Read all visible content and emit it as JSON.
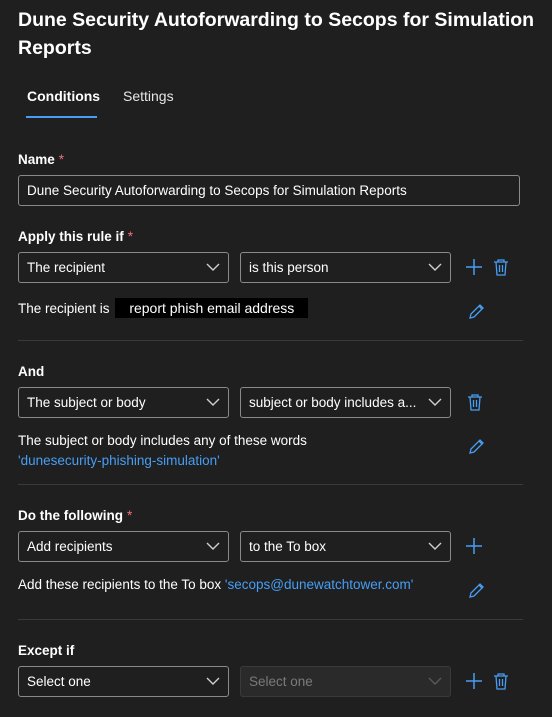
{
  "header": {
    "title": "Dune Security Autoforwarding to Secops for Simulation Reports"
  },
  "tabs": [
    {
      "label": "Conditions",
      "active": true
    },
    {
      "label": "Settings",
      "active": false
    }
  ],
  "name_section": {
    "label": "Name",
    "required_mark": "*",
    "value": "Dune Security Autoforwarding to Secops for Simulation Reports"
  },
  "apply_rule": {
    "label": "Apply this rule if",
    "required_mark": "*",
    "condition": "The recipient",
    "operator": "is this person",
    "desc_prefix": "The recipient is",
    "desc_redacted": "report phish email address"
  },
  "and_section": {
    "label": "And",
    "condition": "The subject or body",
    "operator": "subject or body includes a...",
    "desc_line1": "The subject or body includes any of these words",
    "desc_link": "'dunesecurity-phishing-simulation'"
  },
  "do_following": {
    "label": "Do the following",
    "required_mark": "*",
    "action": "Add recipients",
    "target": "to the To box",
    "desc_prefix": "Add these recipients to the To box",
    "desc_link": "'secops@dunewatchtower.com'"
  },
  "except_if": {
    "label": "Except if",
    "condition": "Select one",
    "operator": "Select one"
  },
  "colors": {
    "background": "#1f1f1f",
    "accent": "#479ef5",
    "required": "#f1707b"
  },
  "icons": [
    "add-icon",
    "delete-icon",
    "edit-icon",
    "chevron-down-icon"
  ]
}
